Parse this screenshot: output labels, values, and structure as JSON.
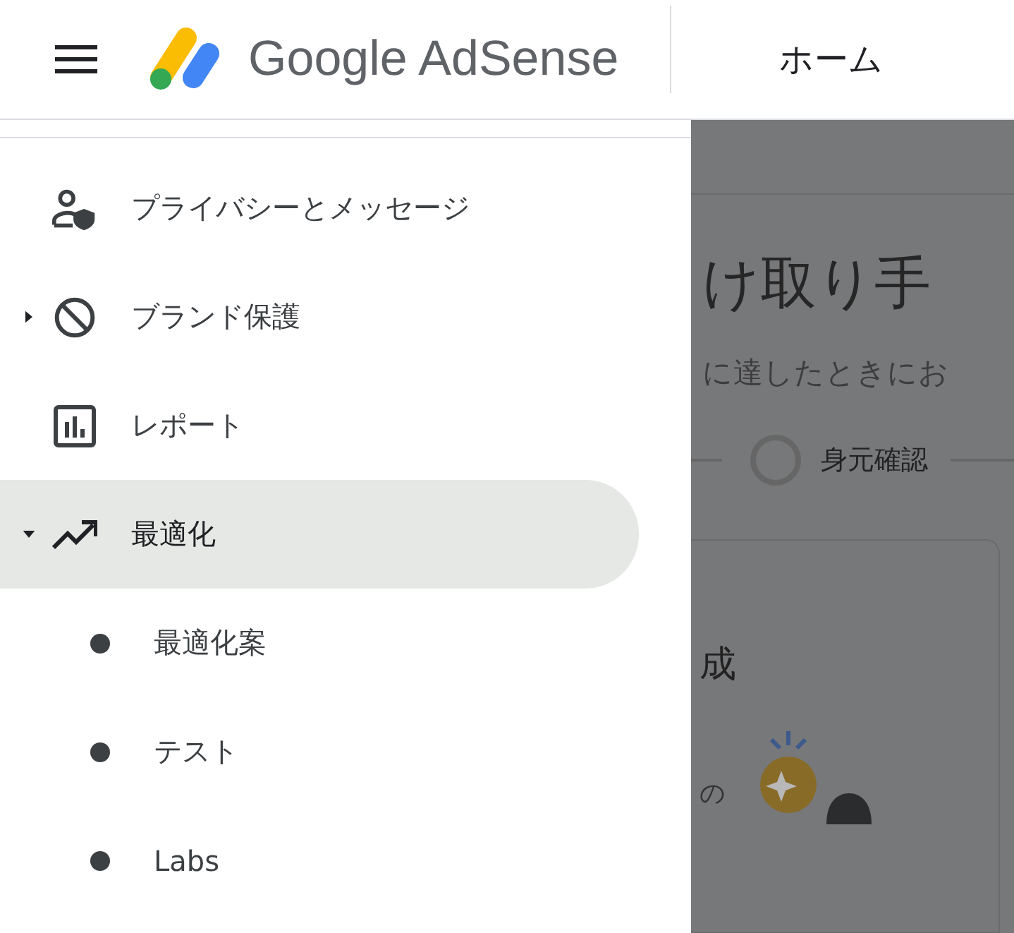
{
  "header": {
    "brand": "Google AdSense",
    "page_title": "ホーム"
  },
  "nav": [
    {
      "kind": "link",
      "label": "プライバシーとメッセージ",
      "selected": false
    },
    {
      "kind": "group",
      "label": "ブランド保護",
      "selected": false,
      "expanded": false
    },
    {
      "kind": "link",
      "label": "レポート",
      "selected": false
    },
    {
      "kind": "group",
      "label": "最適化",
      "selected": true,
      "expanded": true,
      "children": [
        {
          "label": "最適化案",
          "selected": false
        },
        {
          "label": "テスト",
          "selected": false
        },
        {
          "label": "Labs",
          "selected": false
        }
      ]
    }
  ],
  "content": {
    "heading": "け取り手",
    "subtitle": "に達したときにお",
    "step": {
      "label": "身元確認",
      "done": false
    },
    "card": {
      "title": "成",
      "text": "の"
    }
  }
}
